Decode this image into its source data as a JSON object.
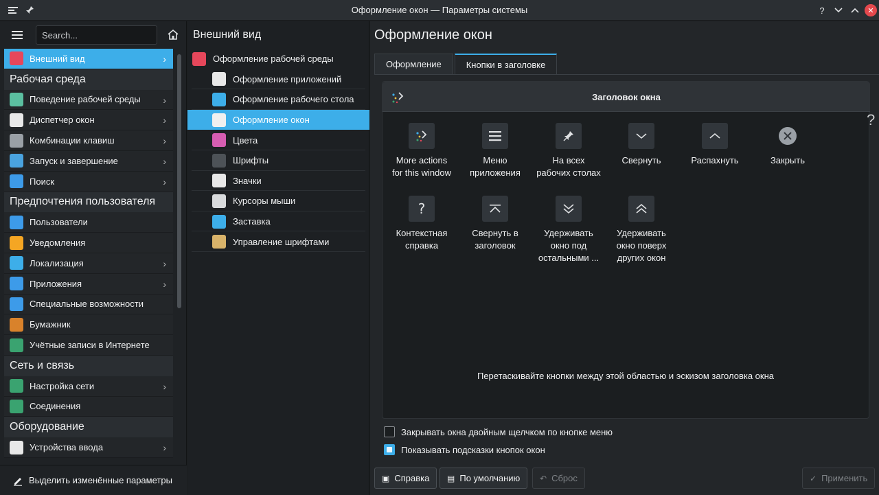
{
  "window": {
    "title": "Оформление окон — Параметры системы",
    "help_glyph": "?",
    "minimize_glyph": "⌄",
    "maximize_glyph": "⌃",
    "close_glyph": "✕"
  },
  "sidebar": {
    "search_placeholder": "Search...",
    "items": [
      {
        "type": "item",
        "label": "Внешний вид",
        "icon": "appearance-icon",
        "chevron": true,
        "active": true,
        "color": "#e6475b"
      },
      {
        "type": "category",
        "label": "Рабочая среда"
      },
      {
        "type": "item",
        "label": "Поведение рабочей среды",
        "icon": "workspace-behavior-icon",
        "chevron": true,
        "color": "#5bbfa0"
      },
      {
        "type": "item",
        "label": "Диспетчер окон",
        "icon": "window-manager-icon",
        "chevron": true,
        "color": "#e8e8e8"
      },
      {
        "type": "item",
        "label": "Комбинации клавиш",
        "icon": "keyboard-icon",
        "chevron": true,
        "color": "#9aa0a6"
      },
      {
        "type": "item",
        "label": "Запуск и завершение",
        "icon": "startup-icon",
        "chevron": true,
        "color": "#4aa3df"
      },
      {
        "type": "item",
        "label": "Поиск",
        "icon": "search-icon",
        "chevron": true,
        "color": "#3d9be9"
      },
      {
        "type": "category",
        "label": "Предпочтения пользователя"
      },
      {
        "type": "item",
        "label": "Пользователи",
        "icon": "users-icon",
        "chevron": false,
        "color": "#3d9be9"
      },
      {
        "type": "item",
        "label": "Уведомления",
        "icon": "bell-icon",
        "chevron": false,
        "color": "#f5a623"
      },
      {
        "type": "item",
        "label": "Локализация",
        "icon": "locale-icon",
        "chevron": true,
        "color": "#3daee9"
      },
      {
        "type": "item",
        "label": "Приложения",
        "icon": "apps-icon",
        "chevron": true,
        "color": "#3d9be9"
      },
      {
        "type": "item",
        "label": "Специальные возможности",
        "icon": "accessibility-icon",
        "chevron": false,
        "color": "#3d9be9"
      },
      {
        "type": "item",
        "label": "Бумажник",
        "icon": "wallet-icon",
        "chevron": false,
        "color": "#d9822b"
      },
      {
        "type": "item",
        "label": "Учётные записи в Интернете",
        "icon": "globe-icon",
        "chevron": false,
        "color": "#3aa370"
      },
      {
        "type": "category",
        "label": "Сеть и связь"
      },
      {
        "type": "item",
        "label": "Настройка сети",
        "icon": "network-icon",
        "chevron": true,
        "color": "#3aa370"
      },
      {
        "type": "item",
        "label": "Соединения",
        "icon": "connections-icon",
        "chevron": false,
        "color": "#3aa370"
      },
      {
        "type": "category",
        "label": "Оборудование"
      },
      {
        "type": "item",
        "label": "Устройства ввода",
        "icon": "input-devices-icon",
        "chevron": true,
        "color": "#e8e8e8"
      }
    ],
    "bottom_button": "Выделить изменённые параметры"
  },
  "midcol": {
    "title": "Внешний вид",
    "items": [
      {
        "label": "Оформление рабочей среды",
        "root": true,
        "active": false,
        "icon": "global-theme-icon",
        "color": "#e6475b"
      },
      {
        "label": "Оформление приложений",
        "root": false,
        "active": false,
        "icon": "app-style-icon",
        "color": "#e8e8e8"
      },
      {
        "label": "Оформление рабочего стола",
        "root": false,
        "active": false,
        "icon": "desktop-theme-icon",
        "color": "#3daee9"
      },
      {
        "label": "Оформление окон",
        "root": false,
        "active": true,
        "icon": "window-decoration-icon",
        "color": "#f0f0f0"
      },
      {
        "label": "Цвета",
        "root": false,
        "active": false,
        "icon": "colors-icon",
        "color": "#d65db1"
      },
      {
        "label": "Шрифты",
        "root": false,
        "active": false,
        "icon": "fonts-icon",
        "color": "#4d5257"
      },
      {
        "label": "Значки",
        "root": false,
        "active": false,
        "icon": "icons-icon",
        "color": "#e8e8e8"
      },
      {
        "label": "Курсоры мыши",
        "root": false,
        "active": false,
        "icon": "cursor-icon",
        "color": "#d8dadc"
      },
      {
        "label": "Заставка",
        "root": false,
        "active": false,
        "icon": "splash-icon",
        "color": "#3daee9"
      },
      {
        "label": "Управление шрифтами",
        "root": false,
        "active": false,
        "icon": "font-manager-icon",
        "color": "#d9b36a"
      }
    ]
  },
  "content": {
    "title": "Оформление окон",
    "tabs": [
      {
        "label": "Оформление",
        "active": false
      },
      {
        "label": "Кнопки в заголовке",
        "active": true
      }
    ],
    "preview_title": "Заголовок окна",
    "help_mark": "?",
    "buttons": [
      {
        "label": "More actions\nfor this window",
        "icon": "more-actions-icon",
        "glyph": "✦"
      },
      {
        "label": "Меню\nприложения",
        "icon": "app-menu-icon",
        "glyph": "☰"
      },
      {
        "label": "На всех\nрабочих столах",
        "icon": "pin-icon",
        "glyph": "📌"
      },
      {
        "label": "Свернуть",
        "icon": "minimize-icon",
        "glyph": "⌄"
      },
      {
        "label": "Распахнуть",
        "icon": "maximize-icon",
        "glyph": "⌃"
      },
      {
        "label": "Закрыть",
        "icon": "close-icon",
        "glyph": "✕"
      },
      {
        "label": "Контекстная\nсправка",
        "icon": "context-help-icon",
        "glyph": "?"
      },
      {
        "label": "Свернуть в\nзаголовок",
        "icon": "shade-icon",
        "glyph": "⌅"
      },
      {
        "label": "Удерживать\nокно под\nостальными ...",
        "icon": "keep-below-icon",
        "glyph": "⌄⌄"
      },
      {
        "label": "Удерживать\nокно поверх\nдругих окон",
        "icon": "keep-above-icon",
        "glyph": "⌃⌃"
      }
    ],
    "drag_hint": "Перетаскивайте кнопки между этой областью и эскизом заголовка окна",
    "checkbox_close_double_click": {
      "label": "Закрывать окна двойным щелчком по кнопке меню",
      "checked": false
    },
    "checkbox_show_tooltips": {
      "label": "Показывать подсказки кнопок окон",
      "checked": true
    }
  },
  "footer": {
    "help": "Справка",
    "defaults": "По умолчанию",
    "reset": "Сброс",
    "apply": "Применить"
  }
}
